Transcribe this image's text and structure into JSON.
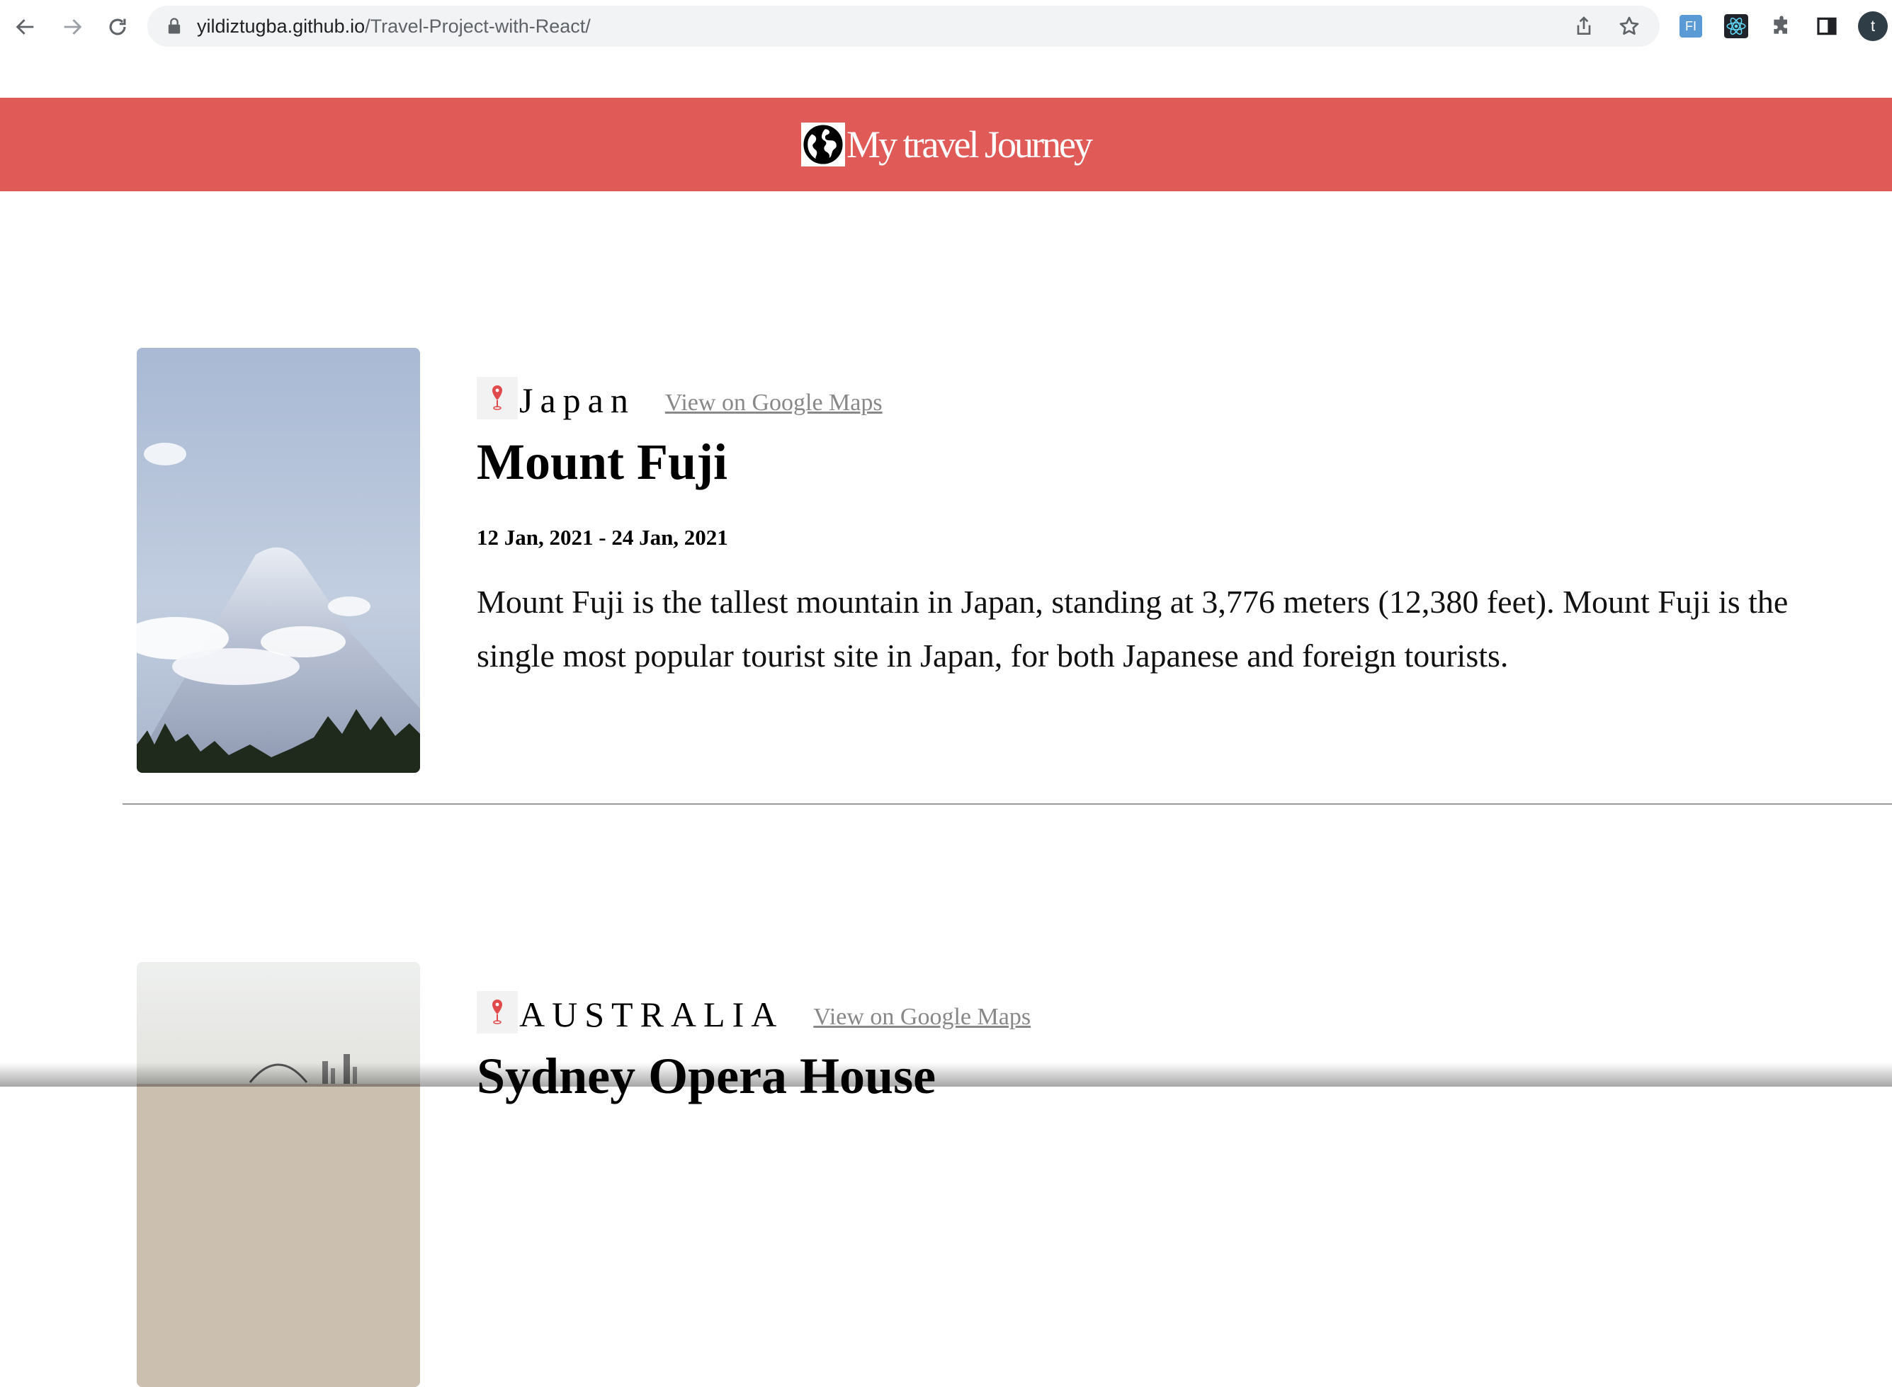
{
  "browser": {
    "url_domain": "yildiztugba.github.io",
    "url_path": "/Travel-Project-with-React/",
    "profile_initial": "t",
    "extension_label": "FI"
  },
  "site": {
    "title": "My travel Journey",
    "accent_color": "#e05a57"
  },
  "entries": [
    {
      "country": "Japan",
      "maps_link": "View on Google Maps",
      "title": "Mount Fuji",
      "dates": "12 Jan, 2021 - 24 Jan, 2021",
      "description": "Mount Fuji is the tallest mountain in Japan, standing at 3,776 meters (12,380 feet). Mount Fuji is the single most popular tourist site in Japan, for both Japanese and foreign tourists."
    },
    {
      "country": "AUSTRALIA",
      "maps_link": "View on Google Maps",
      "title": "Sydney Opera House"
    }
  ],
  "icons": {
    "back": "arrow-left-icon",
    "forward": "arrow-right-icon",
    "reload": "reload-icon",
    "lock": "lock-icon",
    "share": "share-icon",
    "bookmark": "star-icon",
    "react_devtools": "react-icon",
    "extensions": "puzzle-icon",
    "side_panel": "side-panel-icon",
    "logo": "globe-icon",
    "location": "map-pin-icon"
  }
}
